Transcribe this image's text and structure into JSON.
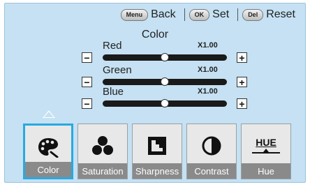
{
  "hints": {
    "menu_key": "Menu",
    "menu_label": "Back",
    "ok_key": "OK",
    "ok_label": "Set",
    "del_key": "Del",
    "del_label": "Reset"
  },
  "panel": {
    "title": "Color"
  },
  "sliders": [
    {
      "label": "Red",
      "value_text": "X1.00",
      "level": 0.5
    },
    {
      "label": "Green",
      "value_text": "X1.00",
      "level": 0.5
    },
    {
      "label": "Blue",
      "value_text": "X1.00",
      "level": 0.5
    }
  ],
  "tiles": [
    {
      "label": "Color",
      "icon": "palette-icon",
      "selected": true
    },
    {
      "label": "Saturation",
      "icon": "three-dots-icon",
      "selected": false
    },
    {
      "label": "Sharpness",
      "icon": "sharpness-icon",
      "selected": false
    },
    {
      "label": "Contrast",
      "icon": "contrast-icon",
      "selected": false
    },
    {
      "label": "Hue",
      "icon": "hue-icon",
      "icon_text": "HUE",
      "selected": false
    }
  ],
  "colors": {
    "background": "#c5e1f3",
    "selection": "#29a9e0",
    "caption": "#8a8a8a"
  }
}
